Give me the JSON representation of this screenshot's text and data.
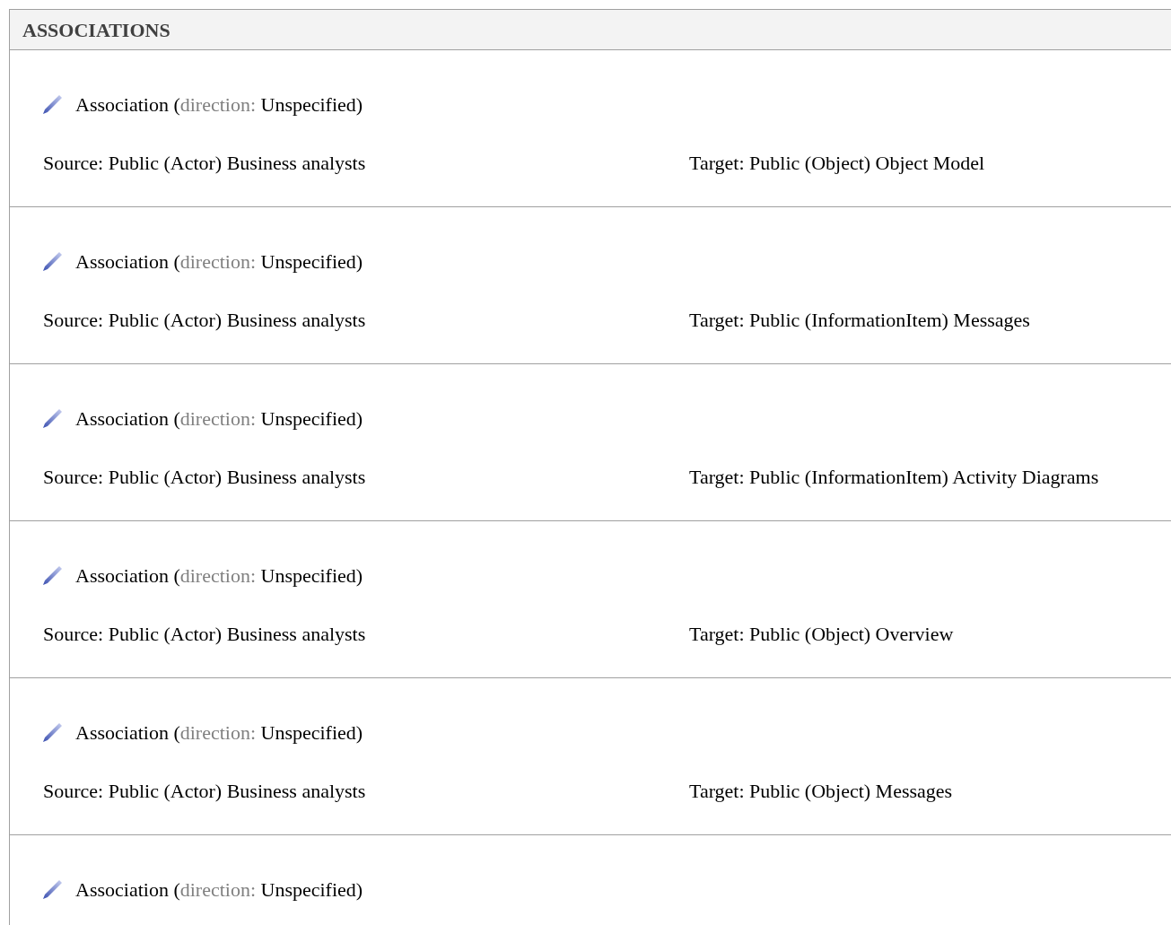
{
  "section": {
    "title": "ASSOCIATIONS"
  },
  "associations": [
    {
      "title_parts": [
        {
          "text": "Association (",
          "muted": false
        },
        {
          "text": "direction:",
          "muted": true
        },
        {
          "text": " Unspecified)",
          "muted": false
        }
      ],
      "source": "Source: Public (Actor) Business analysts",
      "target": "Target: Public (Object) Object Model"
    },
    {
      "title_parts": [
        {
          "text": "Association (",
          "muted": false
        },
        {
          "text": "direction:",
          "muted": true
        },
        {
          "text": " Unspecified)",
          "muted": false
        }
      ],
      "source": "Source: Public (Actor) Business analysts",
      "target": "Target: Public (InformationItem) Messages"
    },
    {
      "title_parts": [
        {
          "text": "Association (",
          "muted": false
        },
        {
          "text": "direction:",
          "muted": true
        },
        {
          "text": " Unspecified)",
          "muted": false
        }
      ],
      "source": "Source: Public (Actor) Business analysts",
      "target": "Target: Public (InformationItem) Activity Diagrams"
    },
    {
      "title_parts": [
        {
          "text": "Association (",
          "muted": false
        },
        {
          "text": "direction:",
          "muted": true
        },
        {
          "text": " Unspecified)",
          "muted": false
        }
      ],
      "source": "Source: Public (Actor) Business analysts",
      "target": "Target: Public (Object) Overview"
    },
    {
      "title_parts": [
        {
          "text": "Association (",
          "muted": false
        },
        {
          "text": "direction:",
          "muted": true
        },
        {
          "text": " Unspecified)",
          "muted": false
        }
      ],
      "source": "Source: Public (Actor) Business analysts",
      "target": "Target: Public (Object) Messages"
    },
    {
      "title_parts": [
        {
          "text": "Association (",
          "muted": false
        },
        {
          "text": "direction:",
          "muted": true
        },
        {
          "text": " Unspecified)",
          "muted": false
        }
      ]
    }
  ]
}
